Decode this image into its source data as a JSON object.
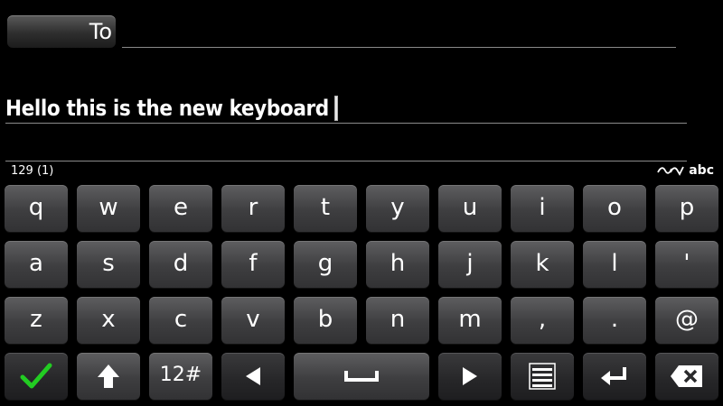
{
  "header": {
    "to_label": "To",
    "recipient_value": ""
  },
  "message": {
    "text": "Hello this is the new keyboard"
  },
  "status": {
    "char_counter": "129 (1)",
    "input_mode": "abc",
    "predictive_icon": "predictive-text-icon"
  },
  "keyboard": {
    "row1": [
      "q",
      "w",
      "e",
      "r",
      "t",
      "y",
      "u",
      "i",
      "o",
      "p"
    ],
    "row2": [
      "a",
      "s",
      "d",
      "f",
      "g",
      "h",
      "j",
      "k",
      "l",
      "'"
    ],
    "row3": [
      "z",
      "x",
      "c",
      "v",
      "b",
      "n",
      "m",
      ",",
      ".",
      "@"
    ],
    "numbers_label": "12#",
    "icons": {
      "done": "checkmark-icon",
      "shift": "shift-arrow-icon",
      "left": "cursor-left-icon",
      "space": "spacebar-icon",
      "right": "cursor-right-icon",
      "options": "menu-lines-icon",
      "enter": "enter-icon",
      "backspace": "backspace-icon"
    },
    "colors": {
      "done_check": "#22cc22",
      "key_top": "#5e5e60",
      "key_bottom": "#323234"
    }
  }
}
